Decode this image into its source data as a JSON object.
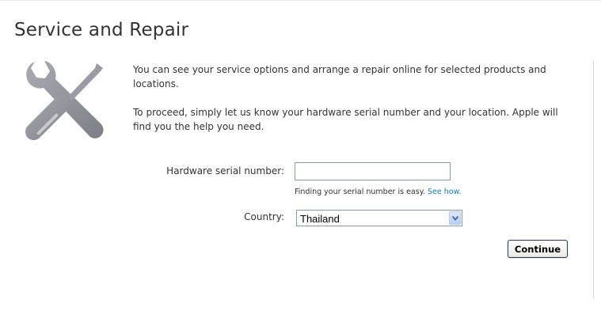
{
  "page": {
    "title": "Service and Repair"
  },
  "intro": {
    "paragraph_1": "You can see your service options and arrange a repair online for selected products and locations.",
    "paragraph_2": "To proceed, simply let us know your hardware serial number and your location. Apple will find you the help you need."
  },
  "form": {
    "serial": {
      "label": "Hardware serial number:",
      "value": "",
      "hint_text": "Finding your serial number is easy. ",
      "hint_link": "See how."
    },
    "country": {
      "label": "Country:",
      "selected": "Thailand"
    },
    "continue_label": "Continue"
  },
  "icons": {
    "tools": "wrench-screwdriver-icon",
    "dropdown": "chevron-down-icon"
  },
  "colors": {
    "icon_fill": "#8e9097",
    "link": "#0e7fbd",
    "button_border": "#1f3b66",
    "input_border": "#7f9db9"
  }
}
